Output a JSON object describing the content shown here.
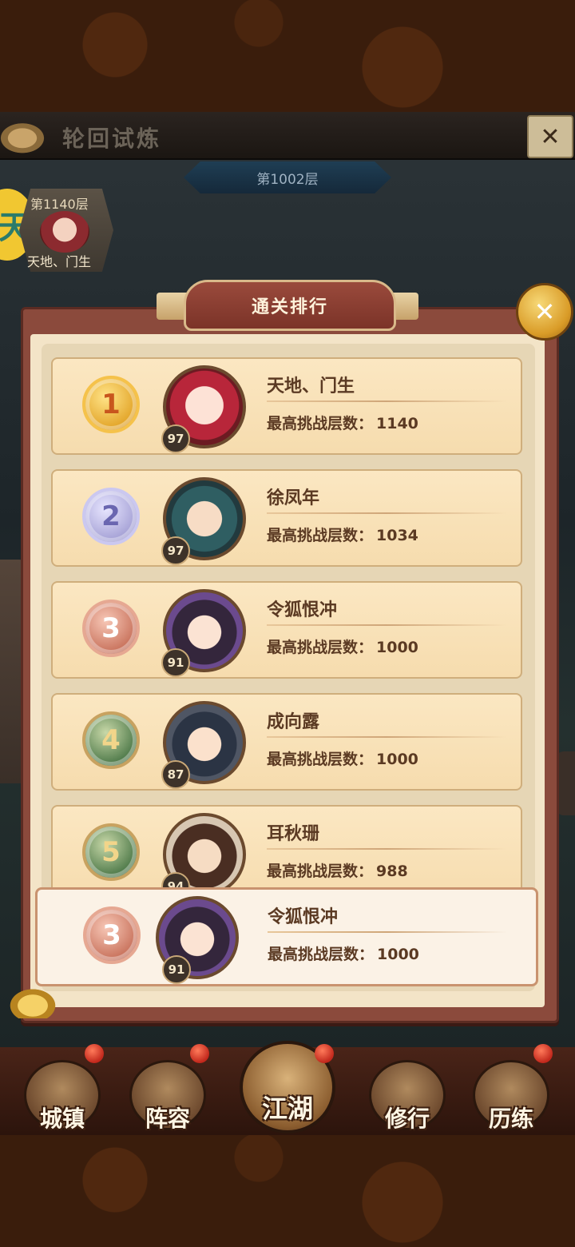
{
  "header": {
    "title": "轮回试炼",
    "floor": "第1002层"
  },
  "user_card": {
    "floor": "第1140层",
    "name": "天地、门生",
    "badge": "天"
  },
  "panel": {
    "title": "通关排行",
    "score_label": "最高挑战层数："
  },
  "rankings": [
    {
      "rank": 1,
      "level": "97",
      "name": "天地、门生",
      "score": "1140"
    },
    {
      "rank": 2,
      "level": "97",
      "name": "徐凤年",
      "score": "1034"
    },
    {
      "rank": 3,
      "level": "91",
      "name": "令狐恨冲",
      "score": "1000"
    },
    {
      "rank": 4,
      "level": "87",
      "name": "成向露",
      "score": "1000"
    },
    {
      "rank": 5,
      "level": "94",
      "name": "耳秋珊",
      "score": "988"
    }
  ],
  "self_entry": {
    "rank": 3,
    "level": "91",
    "name": "令狐恨冲",
    "score": "1000"
  },
  "nav": {
    "items": [
      "城镇",
      "阵容",
      "江湖",
      "修行",
      "历练"
    ]
  },
  "colors": {
    "panel_frame": "#8b4a3c",
    "row_bg": "#fbe7c2",
    "text_main": "#5b3a23"
  },
  "icons": [
    "close-icon",
    "medal-icon",
    "avatar-icon"
  ]
}
